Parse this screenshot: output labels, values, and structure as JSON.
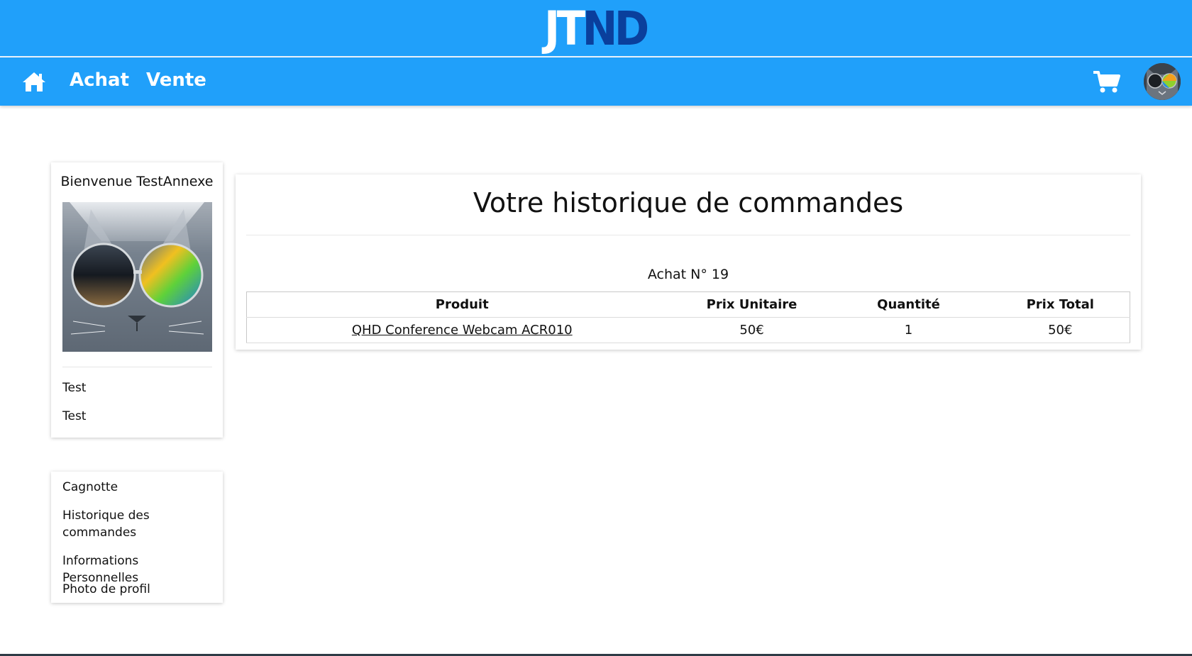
{
  "brand": {
    "logo_part1": "JT",
    "logo_part2": "ND",
    "logo_colors": [
      "#ffffff",
      "#0a3f9c"
    ]
  },
  "nav": {
    "home_icon": "home-icon",
    "links": [
      "Achat",
      "Vente"
    ],
    "cart_icon": "cart-icon",
    "bar_color": "#20a0fa"
  },
  "profile": {
    "welcome": "Bienvenue TestAnnexe",
    "info_lines": [
      "Test",
      "Test"
    ]
  },
  "menu": {
    "items": [
      "Cagnotte",
      "Historique des commandes",
      "Informations Personnelles",
      "Photo de profil"
    ]
  },
  "main": {
    "title": "Votre historique de commandes",
    "orders": [
      {
        "label": "Achat N° 19",
        "headers": [
          "Produit",
          "Prix Unitaire",
          "Quantité",
          "Prix Total"
        ],
        "rows": [
          {
            "product": "QHD Conference Webcam ACR010",
            "unit_price": "50€",
            "quantity": "1",
            "total": "50€"
          }
        ]
      }
    ]
  }
}
